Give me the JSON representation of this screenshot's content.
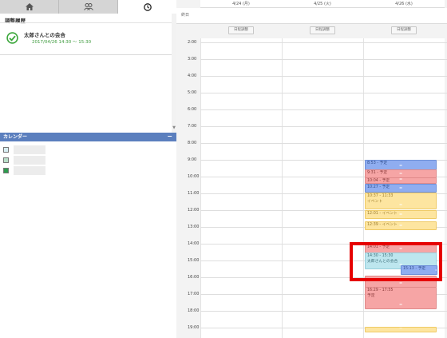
{
  "tabs": [
    {
      "name": "home",
      "icon": "home-icon"
    },
    {
      "name": "users",
      "icon": "users-icon"
    },
    {
      "name": "history",
      "icon": "clock-icon"
    }
  ],
  "history": {
    "title": "調整履歴",
    "items": [
      {
        "title": "太郎さんとの会合",
        "time": "2017/04/26 14:30 ～ 15:30",
        "status_icon": "check-circle-icon"
      }
    ]
  },
  "calendar_section": {
    "title": "カレンダー",
    "collapse_label": "−",
    "colors": [
      "#d8eef3",
      "#b9dfc9",
      "#2e9c4e"
    ]
  },
  "calendar": {
    "columns": [
      {
        "label": "4/24 (月)",
        "adjust_label": "日程調整"
      },
      {
        "label": "4/25 (火)",
        "adjust_label": "日程調整"
      },
      {
        "label": "4/26 (水)",
        "adjust_label": "日程調整"
      }
    ],
    "allday_label": "終日",
    "hours": [
      "2:00",
      "3:00",
      "4:00",
      "5:00",
      "6:00",
      "7:00",
      "8:00",
      "9:00",
      "10:00",
      "11:00",
      "12:00",
      "13:00",
      "14:00",
      "15:00",
      "16:00",
      "17:00",
      "18:00",
      "19:00"
    ],
    "events": [
      {
        "col": 2,
        "start": 9.0,
        "end": 9.6,
        "text": "8:53 - 予定",
        "color": "blue"
      },
      {
        "col": 2,
        "start": 9.55,
        "end": 10.1,
        "text": "9:31 - 予定",
        "color": "red"
      },
      {
        "col": 2,
        "start": 10.05,
        "end": 10.45,
        "text": "10:04 - 予定",
        "color": "red"
      },
      {
        "col": 2,
        "start": 10.45,
        "end": 10.95,
        "text": "10:27 - 予定",
        "color": "blue"
      },
      {
        "col": 2,
        "start": 10.95,
        "end": 11.95,
        "text": "10:37 - 11:33",
        "text2": "イベント",
        "color": "yellow"
      },
      {
        "col": 2,
        "start": 12.0,
        "end": 12.5,
        "text": "12:01 - イベント",
        "color": "yellow"
      },
      {
        "col": 2,
        "start": 12.65,
        "end": 13.2,
        "text": "12:39 - イベント",
        "color": "yellow"
      },
      {
        "col": 2,
        "start": 14.0,
        "end": 14.55,
        "text": "14:01 - 予定",
        "color": "red"
      },
      {
        "col": 2,
        "start": 14.5,
        "end": 15.5,
        "text": "14:30 - 15:30",
        "text2": "太郎さんとの会合",
        "color": "cyan"
      },
      {
        "col": 2,
        "start": 15.3,
        "end": 15.85,
        "text": "15:13 - 予定",
        "color": "blue",
        "offset": 45
      },
      {
        "col": 2,
        "start": 15.9,
        "end": 16.6,
        "text": "",
        "color": "red"
      },
      {
        "col": 2,
        "start": 16.55,
        "end": 17.9,
        "text": "16:29 - 17:55",
        "text2": "予定",
        "color": "red"
      },
      {
        "col": 2,
        "start": 18.95,
        "end": 19.3,
        "text": "",
        "color": "yellow"
      }
    ]
  }
}
